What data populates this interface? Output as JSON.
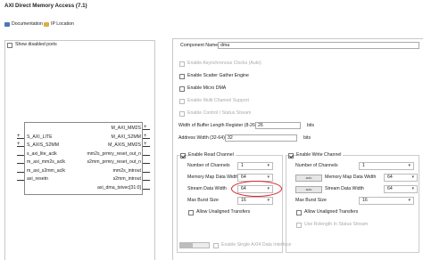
{
  "window": {
    "title": "AXI Direct Memory Access (7.1)"
  },
  "toolbar": {
    "documentation": "Documentation",
    "ip_location": "IP Location"
  },
  "left_panel": {
    "show_disabled_ports": "Show disabled ports",
    "block": {
      "left_ports": [
        "S_AXI_LITE",
        "S_AXIS_S2MM",
        "s_axi_lite_aclk",
        "m_axi_mm2s_aclk",
        "m_axi_s2mm_aclk",
        "axi_resetn"
      ],
      "right_ports": [
        "M_AXI_MM2S",
        "M_AXI_S2MM",
        "M_AXIS_MM2S",
        "mm2s_prmry_reset_out_n",
        "s2mm_prmry_reset_out_n",
        "mm2s_introut",
        "s2mm_introut",
        "axi_dma_tstvec[31:0]"
      ]
    }
  },
  "config": {
    "component_name_label": "Component Name",
    "component_name_value": "dma",
    "options": [
      {
        "label": "Enable Asynchronous Clocks (Auto)",
        "checked": false,
        "disabled": true
      },
      {
        "label": "Enable Scatter Gather Engine",
        "checked": false,
        "disabled": false
      },
      {
        "label": "Enable Micro DMA",
        "checked": false,
        "disabled": false
      },
      {
        "label": "Enable Multi Channel Support",
        "checked": false,
        "disabled": true
      },
      {
        "label": "Enable Control / Status Stream",
        "checked": false,
        "disabled": true
      }
    ],
    "buffer_length_label": "Width of Buffer Length Register (8-26)",
    "buffer_length_value": "26",
    "buffer_length_unit": "bits",
    "address_width_label": "Address Width (32-64)",
    "address_width_value": "32",
    "address_width_unit": "bits",
    "read_channel": {
      "enable_label": "Enable Read Channel",
      "num_channels_label": "Number of Channels",
      "num_channels_value": "1",
      "mm_data_width_label": "Memory Map Data Width",
      "mm_data_width_value": "64",
      "stream_data_width_label": "Stream Data Width",
      "stream_data_width_value": "64",
      "max_burst_label": "Max Burst Size",
      "max_burst_value": "16",
      "unaligned_label": "Allow Unaligned Transfers"
    },
    "write_channel": {
      "enable_label": "Enable Write Channel",
      "num_channels_label": "Number of Channels",
      "num_channels_value": "1",
      "auto_label": "auto",
      "mm_data_width_label": "Memory Map Data Width",
      "mm_data_width_value": "64",
      "stream_data_width_label": "Stream Data Width",
      "stream_data_width_value": "64",
      "max_burst_label": "Max Burst Size",
      "max_burst_value": "16",
      "unaligned_label": "Allow Unaligned Transfers",
      "rxlength_label": "Use Rxlength In Status Stream"
    },
    "single_axi4_label": "Enable Single AXI4 Data Interface"
  },
  "colors": {
    "annotation_circle": "#d8232a",
    "panel_border": "#c8c8c8",
    "accent": "#2a6ab0"
  }
}
